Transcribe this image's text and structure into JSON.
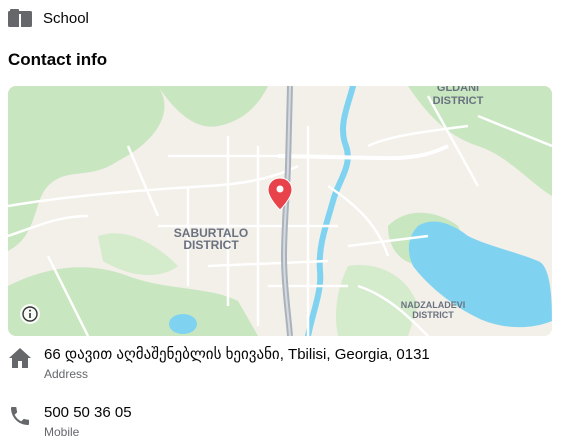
{
  "education": {
    "label": "School",
    "icon": "school-icon"
  },
  "section": {
    "title": "Contact info"
  },
  "map": {
    "labels": {
      "gldani": [
        "GLDANI",
        "DISTRICT"
      ],
      "saburtalo": [
        "SABURTALO",
        "DISTRICT"
      ],
      "nadzaladevi": [
        "NADZALADEVI",
        "DISTRICT"
      ]
    },
    "colors": {
      "land": "#f3efe9",
      "park": "#c8e6c0",
      "water": "#7fd3f0",
      "road": "#ffffff",
      "highway": "#aab3bd",
      "pin": "#e8424a"
    },
    "info_icon": "info-icon"
  },
  "contact": {
    "address": {
      "value": "66 დავით აღმაშენებლის ხეივანი, Tbilisi, Georgia, 0131",
      "label": "Address",
      "icon": "home-icon"
    },
    "mobile": {
      "value": "500 50 36 05",
      "label": "Mobile",
      "icon": "phone-icon"
    }
  }
}
